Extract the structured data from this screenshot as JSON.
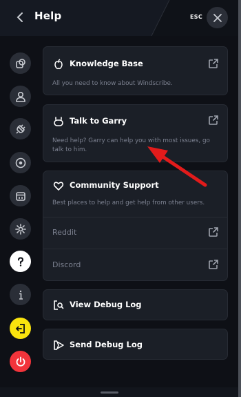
{
  "header": {
    "title": "Help",
    "esc_label": "ESC"
  },
  "sidebar": {
    "items": [
      {
        "icon": "connection-icon"
      },
      {
        "icon": "account-icon"
      },
      {
        "icon": "connection-plug-icon"
      },
      {
        "icon": "robert-icon"
      },
      {
        "icon": "preferences-box-icon"
      },
      {
        "icon": "gear-icon"
      },
      {
        "icon": "help-icon",
        "active": true
      },
      {
        "icon": "info-icon"
      },
      {
        "icon": "logout-icon"
      },
      {
        "icon": "power-icon"
      }
    ]
  },
  "cards": {
    "knowledge_base": {
      "title": "Knowledge Base",
      "description": "All you need to know about Windscribe."
    },
    "talk_to_garry": {
      "title": "Talk to Garry",
      "description": "Need help? Garry can help you with most issues, go talk to him."
    },
    "community_support": {
      "title": "Community Support",
      "description": "Best places to help and get help from other users.",
      "links": [
        {
          "label": "Reddit"
        },
        {
          "label": "Discord"
        }
      ]
    },
    "view_debug_log": {
      "title": "View Debug Log"
    },
    "send_debug_log": {
      "title": "Send Debug Log"
    }
  },
  "colors": {
    "background": "#0e1016",
    "card": "#1b1f27",
    "accent_yellow": "#f9e30e",
    "accent_red": "#f2343b",
    "annotation_arrow": "#e21b1b"
  }
}
